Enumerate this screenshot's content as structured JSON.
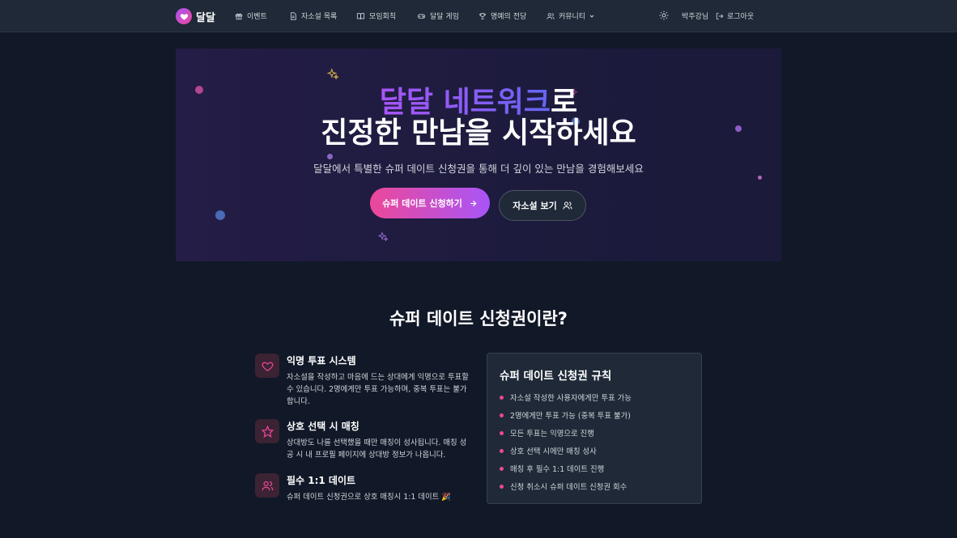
{
  "nav": {
    "logo_text": "달달",
    "items": [
      {
        "label": "이벤트",
        "icon": "gift-icon"
      },
      {
        "label": "자소설 목록",
        "icon": "document-icon"
      },
      {
        "label": "모임회칙",
        "icon": "book-icon"
      },
      {
        "label": "달달 게임",
        "icon": "gamepad-icon"
      },
      {
        "label": "명예의 전당",
        "icon": "trophy-icon"
      },
      {
        "label": "커뮤니티",
        "icon": "users-icon"
      }
    ],
    "theme_icon": "sun-icon",
    "user_name": "박주강님",
    "logout_label": "로그아웃"
  },
  "hero": {
    "title_highlight": "달달 네트워크",
    "title_suffix": "로",
    "title_line2": "진정한 만남을 시작하세요",
    "subtitle": "달달에서 특별한 슈퍼 데이트 신청권을 통해 더 깊이 있는 만남을 경험해보세요",
    "primary_button": "슈퍼 데이트 신청하기",
    "secondary_button": "자소설 보기"
  },
  "about": {
    "title": "슈퍼 데이트 신청권이란?",
    "features": [
      {
        "icon": "heart-icon",
        "title": "익명 투표 시스템",
        "desc": "자소설을 작성하고 마음에 드는 상대에게 익명으로 투표할 수 있습니다. 2명에게만 투표 가능하며, 중복 투표는 불가합니다."
      },
      {
        "icon": "star-icon",
        "title": "상호 선택 시 매칭",
        "desc": "상대방도 나를 선택했을 때만 매칭이 성사됩니다. 매칭 성공 시 내 프로필 페이지에 상대방 정보가 나옵니다."
      },
      {
        "icon": "users-icon",
        "title": "필수 1:1 데이트",
        "desc": "슈퍼 데이트 신청권으로 상호 매칭시 1:1 데이트 🎉"
      }
    ]
  },
  "rules": {
    "title": "슈퍼 데이트 신청권 규칙",
    "items": [
      "자소설 작성한 사용자에게만 투표 가능",
      "2명에게만 투표 가능 (중복 투표 불가)",
      "모든 투표는 익명으로 진행",
      "상호 선택 시에만 매칭 성사",
      "매칭 후 필수 1:1 데이트 진행",
      "신청 취소시 슈퍼 데이트 신청권 회수"
    ]
  },
  "colors": {
    "accent_pink": "#ec4899",
    "accent_purple": "#a855f7",
    "background": "#111827"
  }
}
